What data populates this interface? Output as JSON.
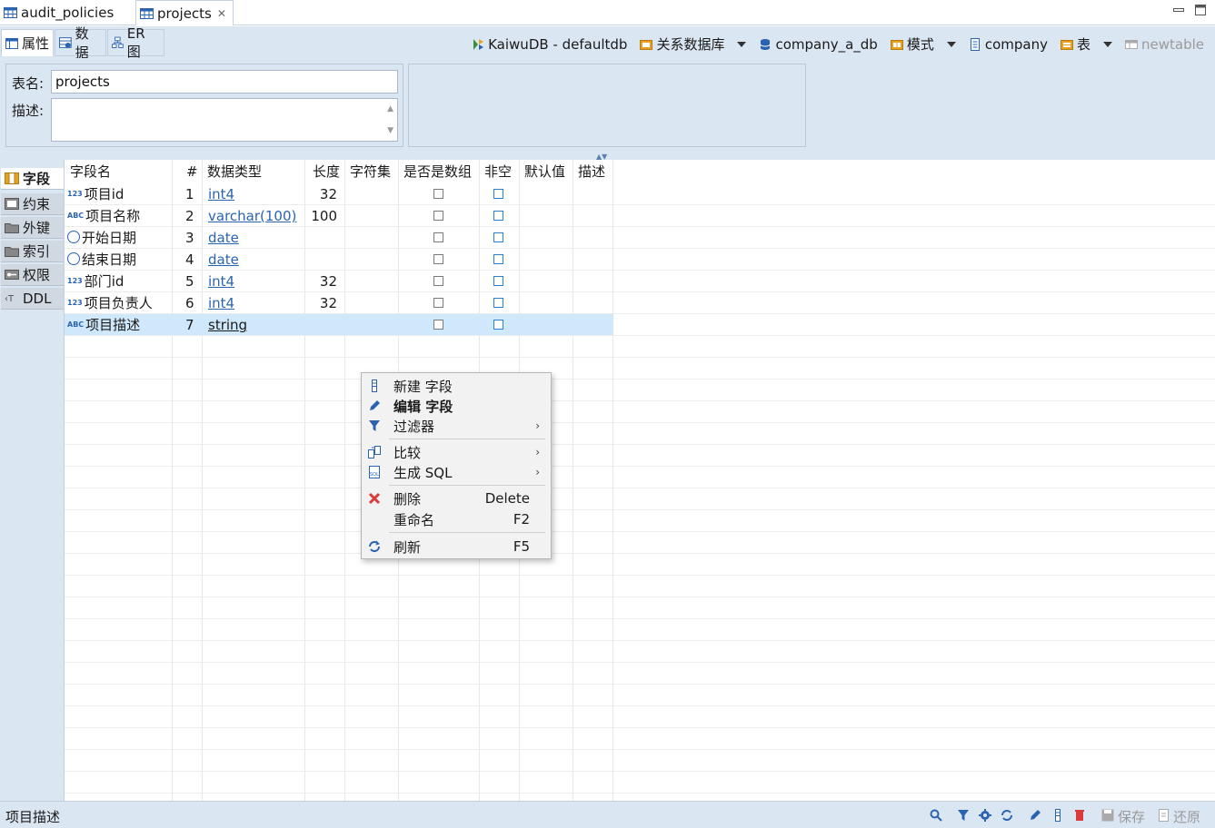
{
  "editor_tabs": [
    {
      "label": "audit_policies",
      "icon": "table-icon"
    },
    {
      "label": "projects",
      "icon": "table-icon",
      "close": "✕"
    }
  ],
  "sub_tabs": [
    {
      "label": "属性",
      "icon": "properties-icon"
    },
    {
      "label": "数据",
      "icon": "data-icon"
    },
    {
      "label": "ER 图",
      "icon": "er-diagram-icon"
    }
  ],
  "breadcrumbs": [
    {
      "label": "KaiwuDB - defaultdb",
      "icon": "kaiwudb-connection-icon"
    },
    {
      "label": "关系数据库",
      "icon": "database-folder-icon",
      "dropdown": true
    },
    {
      "label": "company_a_db",
      "icon": "database-icon"
    },
    {
      "label": "模式",
      "icon": "schema-folder-icon",
      "dropdown": true
    },
    {
      "label": "company",
      "icon": "schema-icon"
    },
    {
      "label": "表",
      "icon": "tables-folder-icon",
      "dropdown": true
    },
    {
      "label": "newtable",
      "icon": "new-table-icon",
      "disabled": true
    }
  ],
  "props": {
    "name_label": "表名:",
    "name_value": "projects",
    "desc_label": "描述:",
    "desc_value": ""
  },
  "side_tabs": [
    {
      "label": "字段",
      "icon": "columns-icon",
      "active": true
    },
    {
      "label": "约束",
      "icon": "constraints-icon"
    },
    {
      "label": "外键",
      "icon": "foreign-keys-icon"
    },
    {
      "label": "索引",
      "icon": "indexes-icon"
    },
    {
      "label": "权限",
      "icon": "permissions-icon"
    },
    {
      "label": "DDL",
      "icon": "ddl-icon"
    }
  ],
  "grid": {
    "headers": [
      "字段名",
      "#",
      "数据类型",
      "长度",
      "字符集",
      "是否是数组",
      "非空",
      "默认值",
      "描述"
    ],
    "rows": [
      {
        "type_icon": "123",
        "name": "项目id",
        "num": "1",
        "dtype": "int4",
        "link": true,
        "length": "32"
      },
      {
        "type_icon": "ABC",
        "name": "项目名称",
        "num": "2",
        "dtype": "varchar(100)",
        "link": true,
        "length": "100"
      },
      {
        "type_icon": "clock",
        "name": "开始日期",
        "num": "3",
        "dtype": "date",
        "link": true,
        "length": ""
      },
      {
        "type_icon": "clock",
        "name": "结束日期",
        "num": "4",
        "dtype": "date",
        "link": true,
        "length": ""
      },
      {
        "type_icon": "123",
        "name": "部门id",
        "num": "5",
        "dtype": "int4",
        "link": true,
        "length": "32"
      },
      {
        "type_icon": "123",
        "name": "项目负责人",
        "num": "6",
        "dtype": "int4",
        "link": true,
        "length": "32"
      },
      {
        "type_icon": "ABC",
        "name": "项目描述",
        "num": "7",
        "dtype": "string",
        "link": false,
        "length": "",
        "selected": true
      }
    ]
  },
  "context_menu": [
    {
      "label": "新建 字段",
      "icon": "new-column-icon"
    },
    {
      "label": "编辑 字段",
      "icon": "edit-icon",
      "bold": true
    },
    {
      "label": "过滤器",
      "icon": "filter-icon",
      "submenu": "›"
    },
    {
      "label": "比较",
      "icon": "compare-icon",
      "submenu": "›"
    },
    {
      "label": "生成 SQL",
      "icon": "generate-sql-icon",
      "submenu": "›"
    },
    {
      "label": "删除",
      "icon": "delete-icon",
      "shortcut": "Delete"
    },
    {
      "label": "重命名",
      "icon": "",
      "shortcut": "F2"
    },
    {
      "label": "刷新",
      "icon": "refresh-icon",
      "shortcut": "F5"
    }
  ],
  "status": {
    "text": "项目描述",
    "save_label": "保存",
    "revert_label": "还原"
  },
  "colors": {
    "panel_bg": "#dbe6f3",
    "link": "#2a64b0",
    "selected_row": "#cfe8fb",
    "delete_red": "#d93a3a",
    "accent_orange": "#e8a020"
  }
}
